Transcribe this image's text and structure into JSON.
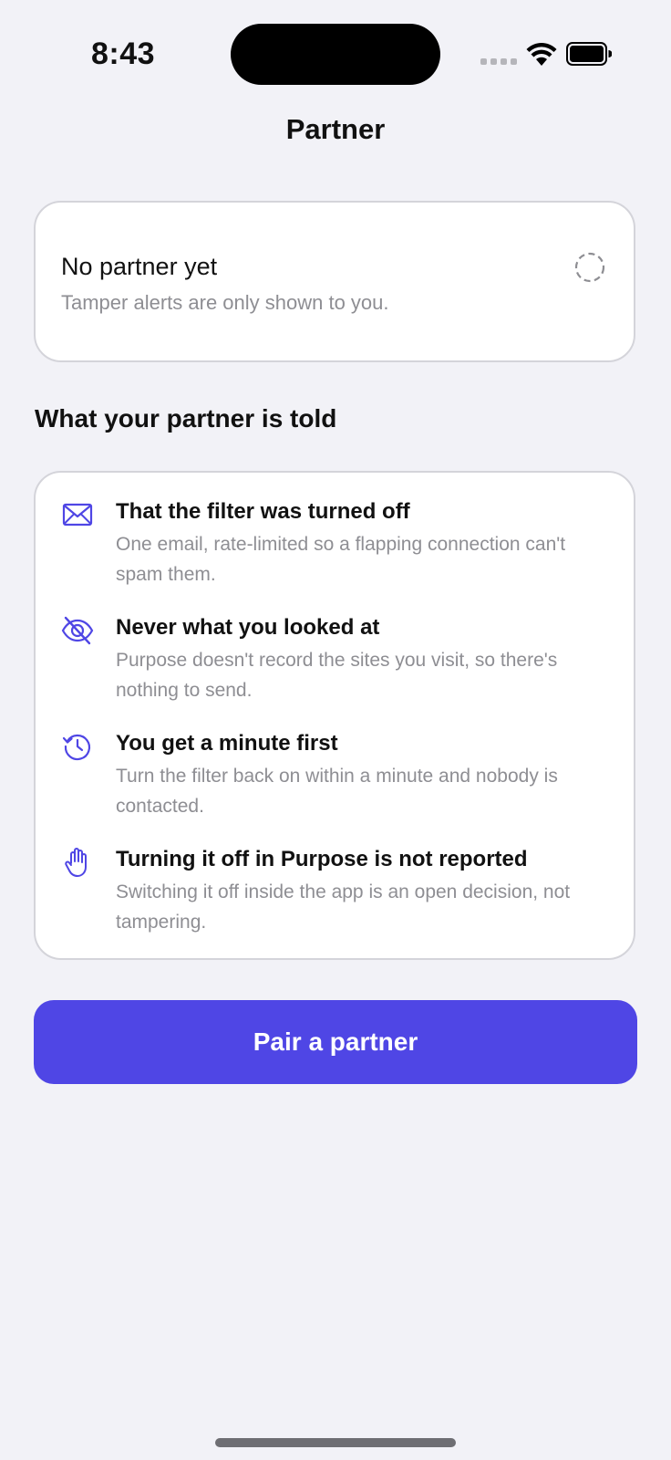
{
  "status_bar": {
    "time": "8:43"
  },
  "nav": {
    "title": "Partner"
  },
  "partner_card": {
    "title": "No partner yet",
    "subtitle": "Tamper alerts are only shown to you.",
    "status_icon": "dashed-circle-icon"
  },
  "section": {
    "title": "What your partner is told"
  },
  "info_items": [
    {
      "icon": "envelope-icon",
      "title": "That the filter was turned off",
      "text": "One email, rate-limited so a flapping connection can't spam them."
    },
    {
      "icon": "eye-slash-icon",
      "title": "Never what you looked at",
      "text": "Purpose doesn't record the sites you visit, so there's nothing to send."
    },
    {
      "icon": "clock-history-icon",
      "title": "You get a minute first",
      "text": "Turn the filter back on within a minute and nobody is contacted."
    },
    {
      "icon": "raised-hand-icon",
      "title": "Turning it off in Purpose is not reported",
      "text": "Switching it off inside the app is an open decision, not tampering."
    }
  ],
  "pair_button": {
    "label": "Pair a partner"
  },
  "colors": {
    "accent": "#4f46e5",
    "background": "#f2f2f7",
    "secondary_text": "#8e8e93"
  }
}
